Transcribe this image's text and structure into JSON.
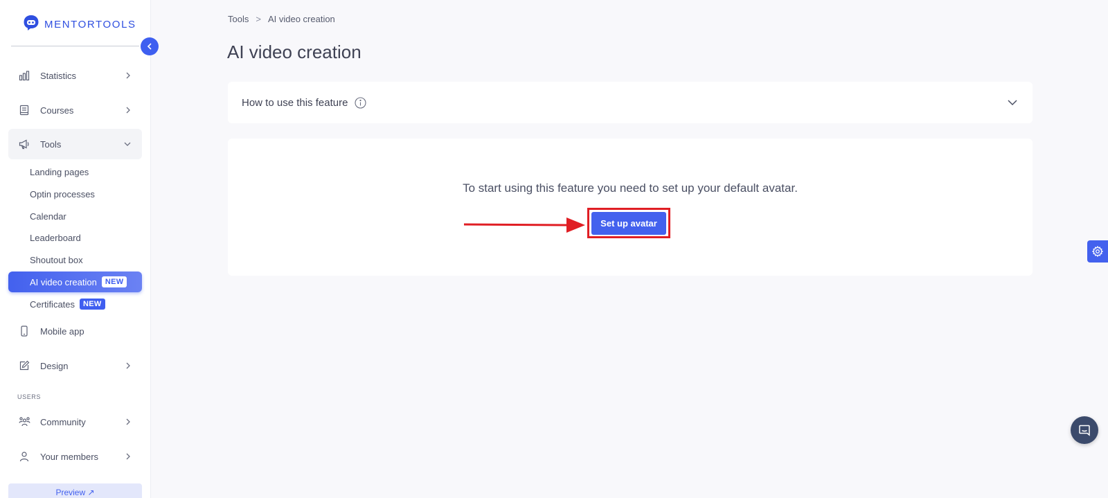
{
  "brand": {
    "name": "MENTORTOOLS",
    "color": "#2f4fe0"
  },
  "colors": {
    "accent": "#4361ee",
    "highlight": "#e01e24",
    "chat": "#3b4a6b"
  },
  "sidebar": {
    "items": [
      {
        "label": "Statistics",
        "icon": "bar-chart-icon"
      },
      {
        "label": "Courses",
        "icon": "book-icon"
      },
      {
        "label": "Tools",
        "icon": "megaphone-icon",
        "expanded": true
      },
      {
        "label": "Mobile app",
        "icon": "phone-icon"
      },
      {
        "label": "Design",
        "icon": "pencil-icon"
      }
    ],
    "tools_submenu": [
      {
        "label": "Landing pages"
      },
      {
        "label": "Optin processes"
      },
      {
        "label": "Calendar"
      },
      {
        "label": "Leaderboard"
      },
      {
        "label": "Shoutout box"
      },
      {
        "label": "AI video creation",
        "badge": "NEW",
        "active": true
      },
      {
        "label": "Certificates",
        "badge": "NEW"
      }
    ],
    "users_section": {
      "label": "USERS",
      "items": [
        {
          "label": "Community",
          "icon": "community-icon"
        },
        {
          "label": "Your members",
          "icon": "user-icon"
        }
      ]
    },
    "preview_label": "Preview ↗"
  },
  "breadcrumb": {
    "parent": "Tools",
    "separator": ">",
    "current": "AI video creation"
  },
  "page": {
    "title": "AI video creation",
    "accordion_label": "How to use this feature",
    "message": "To start using this feature you need to set up your default avatar.",
    "cta_label": "Set up avatar"
  }
}
